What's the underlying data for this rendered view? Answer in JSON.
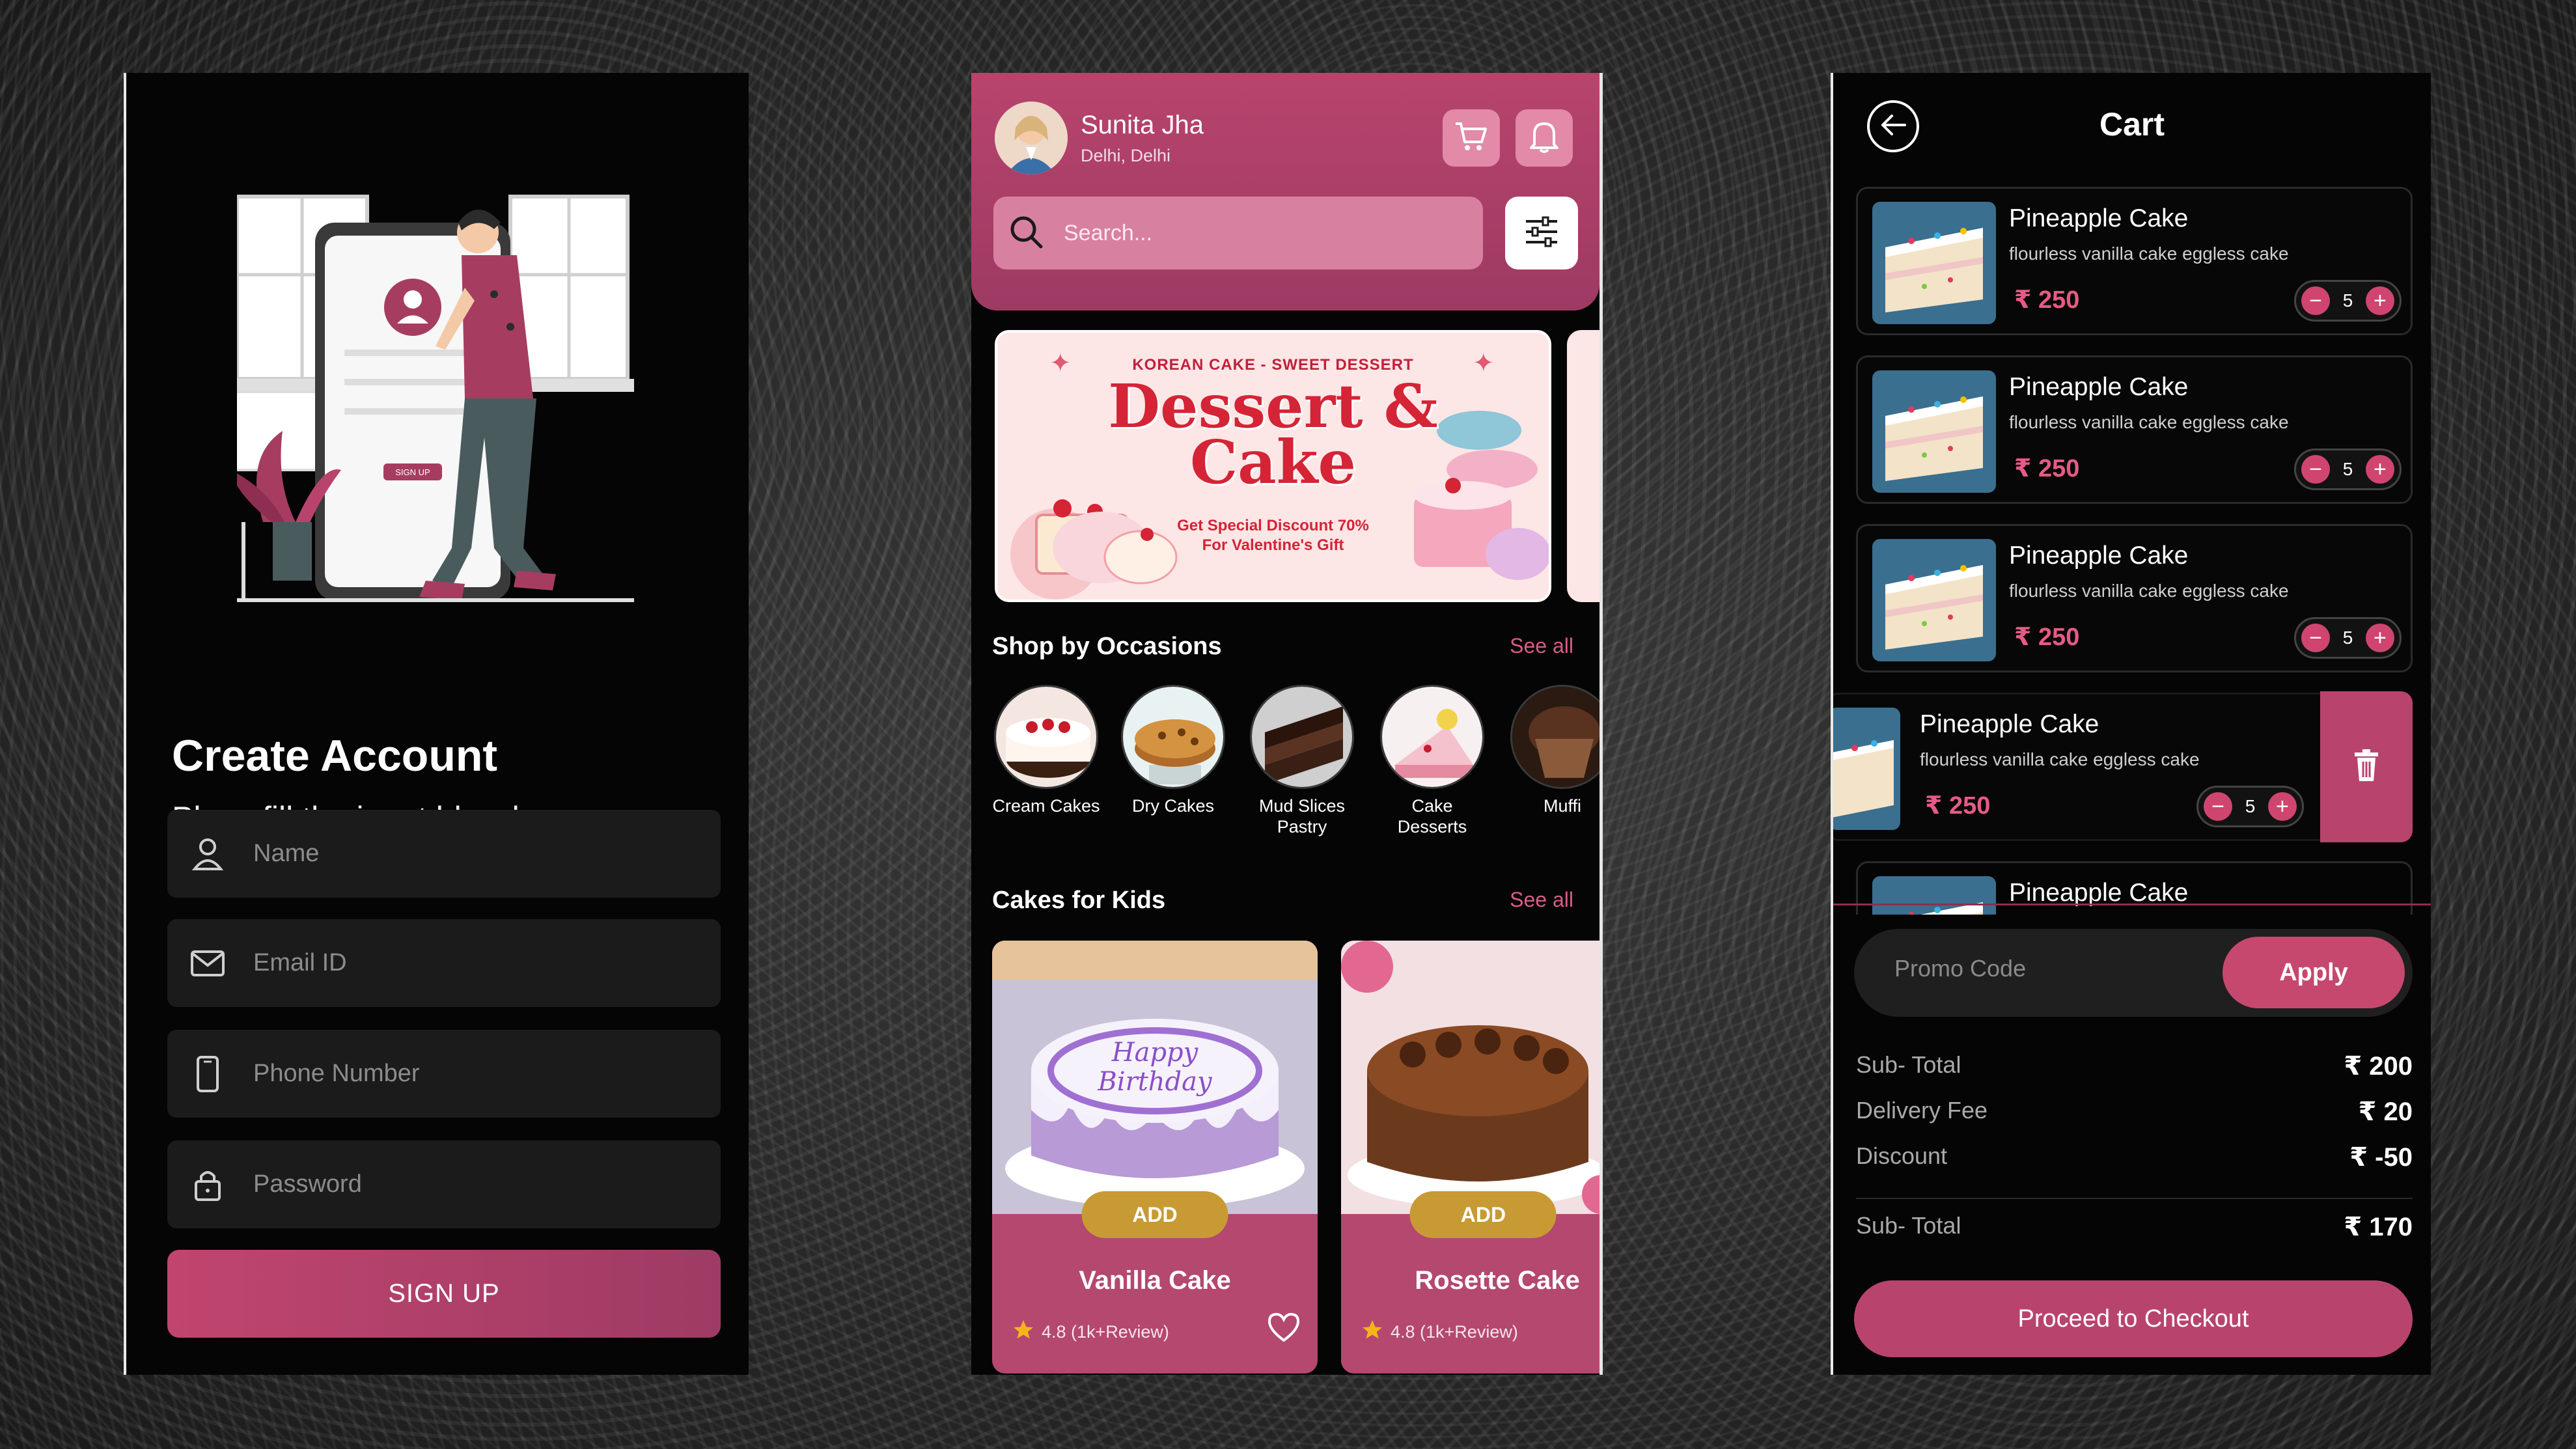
{
  "colors": {
    "accent": "#b8446d",
    "accent_light": "#d75d88",
    "gold": "#c89a34",
    "background": "#050505",
    "text": "#ffffff"
  },
  "signup": {
    "illustration": {
      "button_label": "SIGN UP"
    },
    "title": "Create Account",
    "subtitle": "Plese fill the input blow here",
    "fields": [
      {
        "placeholder": "Name",
        "icon": "user-icon"
      },
      {
        "placeholder": "Email ID",
        "icon": "mail-icon"
      },
      {
        "placeholder": "Phone Number",
        "icon": "phone-icon"
      },
      {
        "placeholder": "Password",
        "icon": "lock-icon"
      }
    ],
    "button_label": "SIGN UP"
  },
  "home": {
    "user": {
      "name": "Sunita Jha",
      "location": "Delhi, Delhi"
    },
    "icons": {
      "cart": "cart-icon",
      "notification": "bell-icon",
      "filter": "filter-icon",
      "search": "search-icon"
    },
    "search": {
      "placeholder": "Search..."
    },
    "banner": {
      "tag": "KOREAN CAKE - SWEET DESSERT",
      "title_line1": "Dessert &",
      "title_line2": "Cake",
      "sub_line1": "Get Special Discount 70%",
      "sub_line2": "For Valentine's Gift"
    },
    "occasions": {
      "title": "Shop by Occasions",
      "see_all": "See all",
      "items": [
        {
          "label": "Cream Cakes"
        },
        {
          "label": "Dry Cakes"
        },
        {
          "label": "Mud Slices Pastry"
        },
        {
          "label": "Cake Desserts"
        },
        {
          "label": "Muffi"
        }
      ]
    },
    "kids": {
      "title": "Cakes for Kids",
      "see_all": "See all",
      "items": [
        {
          "name": "Vanilla Cake",
          "rating": "4.8 (1k+Review)",
          "add_label": "ADD",
          "cake_text_1": "Happy",
          "cake_text_2": "Birthday"
        },
        {
          "name": "Rosette Cake",
          "rating": "4.8 (1k+Review)",
          "add_label": "ADD"
        }
      ]
    }
  },
  "cart": {
    "title": "Cart",
    "items": [
      {
        "name": "Pineapple Cake",
        "desc": "flourless vanilla cake eggless cake",
        "price": "₹ 250",
        "qty": "5"
      },
      {
        "name": "Pineapple Cake",
        "desc": "flourless vanilla cake eggless cake",
        "price": "₹ 250",
        "qty": "5"
      },
      {
        "name": "Pineapple Cake",
        "desc": "flourless vanilla cake eggless cake",
        "price": "₹ 250",
        "qty": "5"
      },
      {
        "name": "Pineapple Cake",
        "desc": "flourless vanilla cake eggless cake",
        "price": "₹ 250",
        "qty": "5"
      },
      {
        "name": "Pineapple Cake"
      }
    ],
    "stepper": {
      "minus": "−",
      "plus": "+"
    },
    "promo": {
      "placeholder": "Promo Code",
      "apply_label": "Apply"
    },
    "summary": [
      {
        "label": "Sub- Total",
        "value": "₹ 200"
      },
      {
        "label": "Delivery Fee",
        "value": "₹ 20"
      },
      {
        "label": "Discount",
        "value": "₹ -50"
      }
    ],
    "total": {
      "label": "Sub- Total",
      "value": "₹ 170"
    },
    "checkout_label": "Proceed to Checkout"
  }
}
